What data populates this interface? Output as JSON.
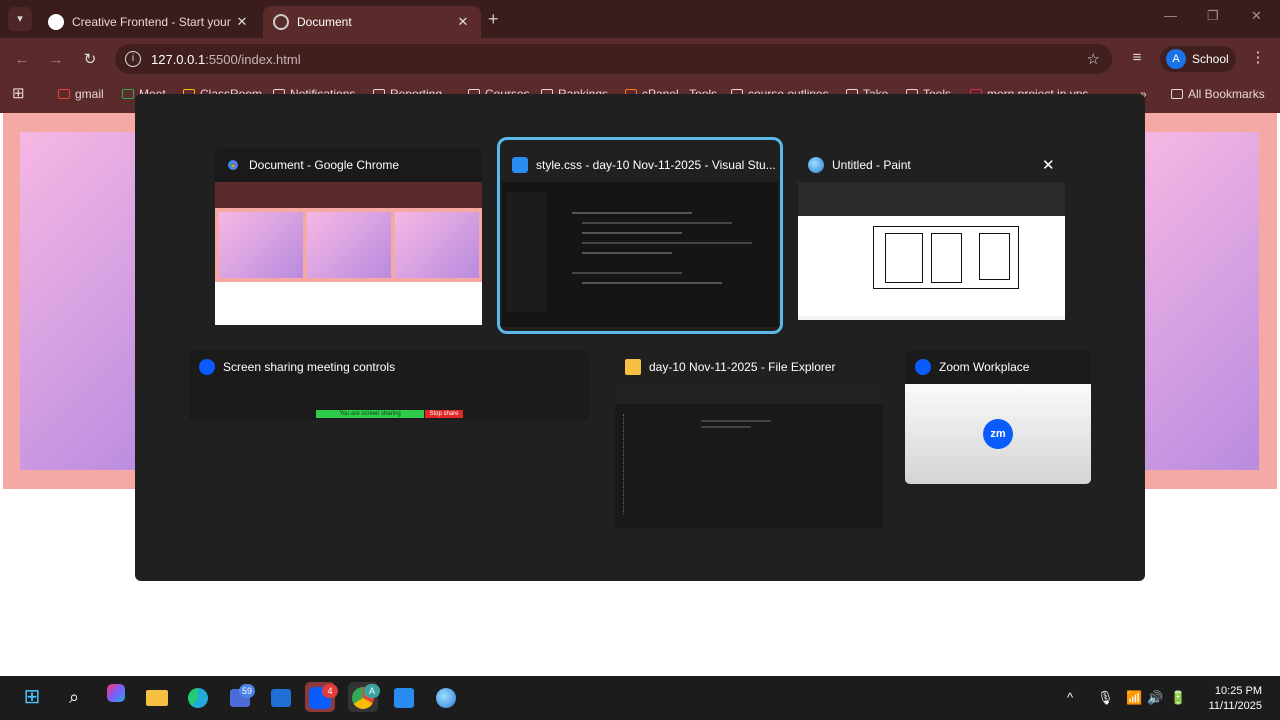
{
  "tabs": [
    {
      "title": "Creative Frontend - Start your F",
      "close": "✕"
    },
    {
      "title": "Document",
      "close": "✕"
    }
  ],
  "tab_search_icon": "chevron-down-icon",
  "new_tab": "+",
  "window_controls": {
    "minimize": "—",
    "restore": "❐",
    "close": "✕"
  },
  "toolbar": {
    "back": "←",
    "forward": "→",
    "reload": "↻",
    "site_info": "i"
  },
  "address": {
    "host": "127.0.0.1",
    "path": ":5500/index.html",
    "star": "☆"
  },
  "profile": {
    "initial": "A",
    "name": "School"
  },
  "menu_icon": "⋮",
  "media_icon": "≡",
  "apps_icon": "⊞",
  "bookmarks": [
    "gmail",
    "Meet",
    "ClassRoom",
    "Notifications",
    "Reporting",
    "Courses",
    "Rankings",
    "cPanel - Tools",
    "course outlines",
    "Take",
    "Tools",
    "mern project in vps"
  ],
  "bookmarks_overflow": "»",
  "all_bookmarks": "All Bookmarks",
  "switcher": {
    "windows": [
      {
        "title": "Document - Google Chrome",
        "app": "chrome"
      },
      {
        "title": "style.css - day-10 Nov-11-2025 - Visual Stu...",
        "app": "vscode",
        "selected": true
      },
      {
        "title": "Untitled - Paint",
        "app": "paint",
        "close": "✕"
      },
      {
        "title": "Screen sharing meeting controls",
        "app": "zoom",
        "share_text": "You are screen sharing",
        "stop_text": "Stop share"
      },
      {
        "title": "day-10 Nov-11-2025 - File Explorer",
        "app": "explorer"
      },
      {
        "title": "Zoom Workplace",
        "app": "zoom",
        "logo": "zm"
      }
    ]
  },
  "taskbar": {
    "apps": [
      "start-icon",
      "search-icon",
      "copilot-icon",
      "file-explorer-icon",
      "edge-icon",
      "teams-icon",
      "outlook-icon",
      "zoom-icon",
      "chrome-icon",
      "vscode-icon",
      "paint-icon"
    ],
    "teams_badge": "59",
    "zoom_badge": "4",
    "chrome_badge": "A",
    "time": "10:25 PM",
    "date": "11/11/2025",
    "tray_chevron": "^",
    "colors": {
      "accent": "#5cb8e6",
      "chrome_frame": "#5b2b2b",
      "page_band": "#f5a9a4"
    }
  }
}
